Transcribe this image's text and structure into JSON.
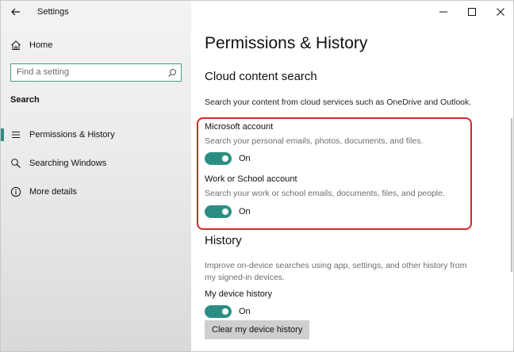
{
  "app": {
    "title": "Settings"
  },
  "sidebar": {
    "home_label": "Home",
    "search_placeholder": "Find a setting",
    "section_label": "Search",
    "items": [
      {
        "label": "Permissions & History",
        "active": true,
        "icon": "list-icon"
      },
      {
        "label": "Searching Windows",
        "active": false,
        "icon": "search-icon"
      },
      {
        "label": "More details",
        "active": false,
        "icon": "info-icon"
      }
    ]
  },
  "main": {
    "page_title": "Permissions & History",
    "cloud": {
      "title": "Cloud content search",
      "description": "Search your content from cloud services such as OneDrive and Outlook.",
      "microsoft_account": {
        "label": "Microsoft account",
        "description": "Search your personal emails, photos, documents, and files.",
        "toggle_state": "On"
      },
      "work_account": {
        "label": "Work or School account",
        "description": "Search your work or school emails, documents, files, and people.",
        "toggle_state": "On"
      }
    },
    "history": {
      "title": "History",
      "description": "Improve on-device searches using app, settings, and other history from my signed-in devices.",
      "device_history": {
        "label": "My device history",
        "toggle_state": "On"
      },
      "clear_button": "Clear my device history"
    }
  },
  "colors": {
    "accent": "#2a8f82",
    "highlight": "#d9262b",
    "search_border": "#4a9c8c"
  }
}
